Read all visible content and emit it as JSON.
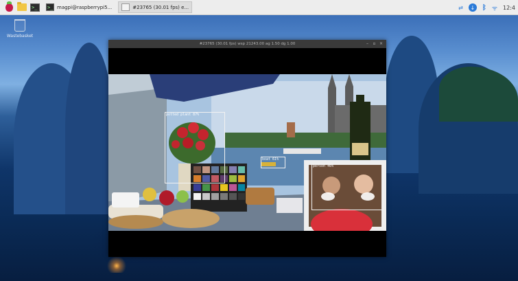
{
  "taskbar": {
    "apps": [
      {
        "label": "magpi@raspberrypi5..."
      },
      {
        "label": "#23765 (30.01 fps) e..."
      }
    ],
    "clock": "12:4"
  },
  "desktop": {
    "wastebasket_label": "Wastebasket"
  },
  "window": {
    "title": "#23765 (30.01 fps) wsp 21243.00 ag 1.50 dg 1.00"
  },
  "detections": [
    {
      "label": "potted plant 87%"
    },
    {
      "label": "boat 61%"
    },
    {
      "label": "person 46%"
    }
  ]
}
